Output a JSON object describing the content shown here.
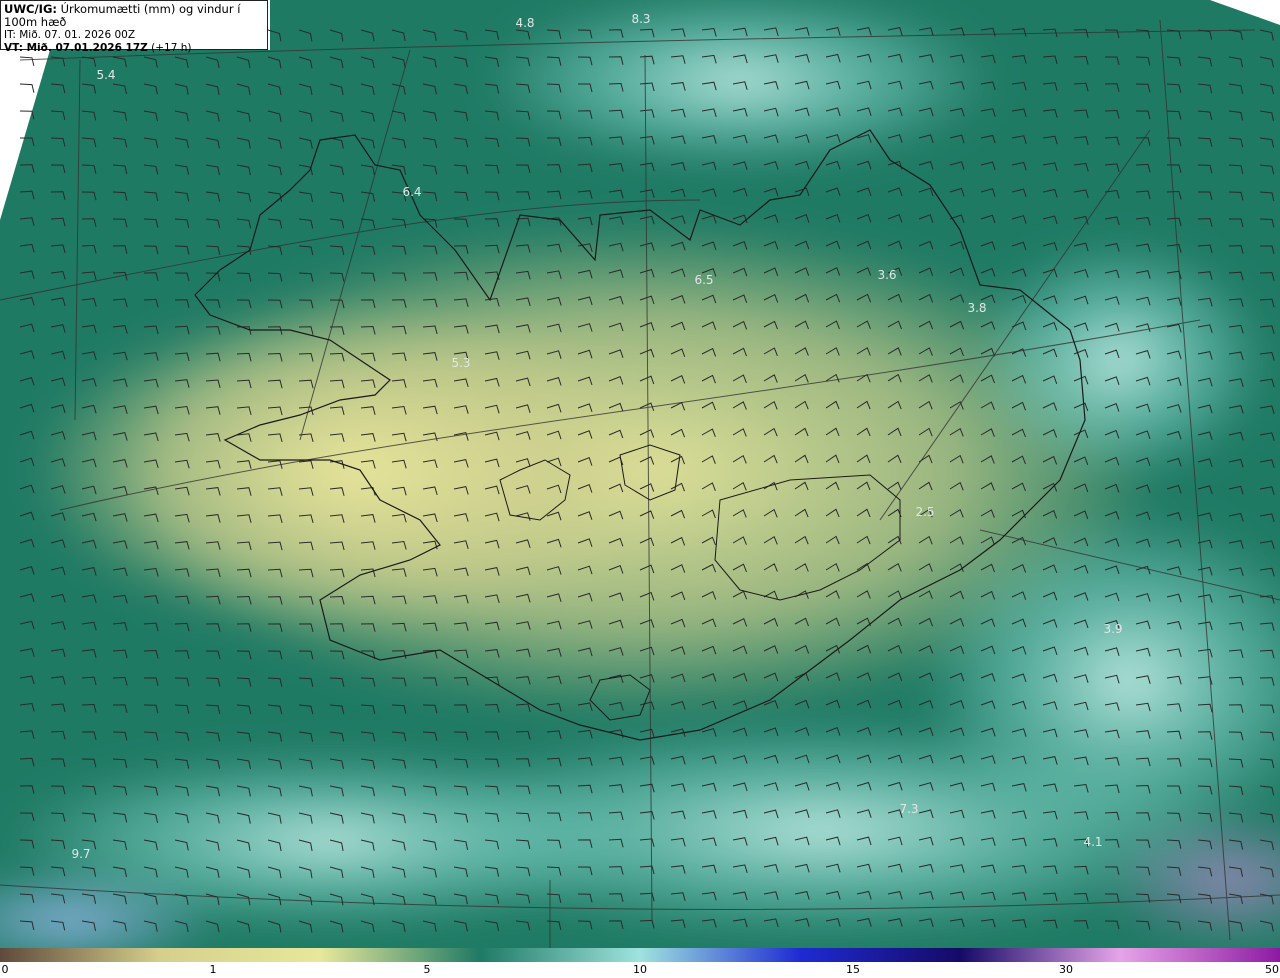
{
  "header": {
    "product": "UWC/IG:",
    "title": "Úrkomumætti (mm) og vindur í 100m hæð",
    "it_label": "IT:",
    "it_value": "Mið. 07. 01. 2026 00Z",
    "vt_label": "VT: Mið. 07.01.2026 17Z",
    "vt_lead": "(+17 h)"
  },
  "map_labels": [
    "4.8",
    "8.3",
    "5.4",
    "6.4",
    "6.5",
    "3.6",
    "3.8",
    "5.3",
    "2.5",
    "3.9",
    "7.3",
    "4.1",
    "9.7"
  ],
  "legend": {
    "ticks": [
      "0",
      "1",
      "5",
      "10",
      "15",
      "30",
      "50"
    ],
    "colors": [
      "#5e4a3c",
      "#d6cf8c",
      "#e7e89b",
      "#1f7a64",
      "#9fe3df",
      "#1e2bd2",
      "#150a66",
      "#e6a4e8",
      "#8d1aa2"
    ]
  }
}
